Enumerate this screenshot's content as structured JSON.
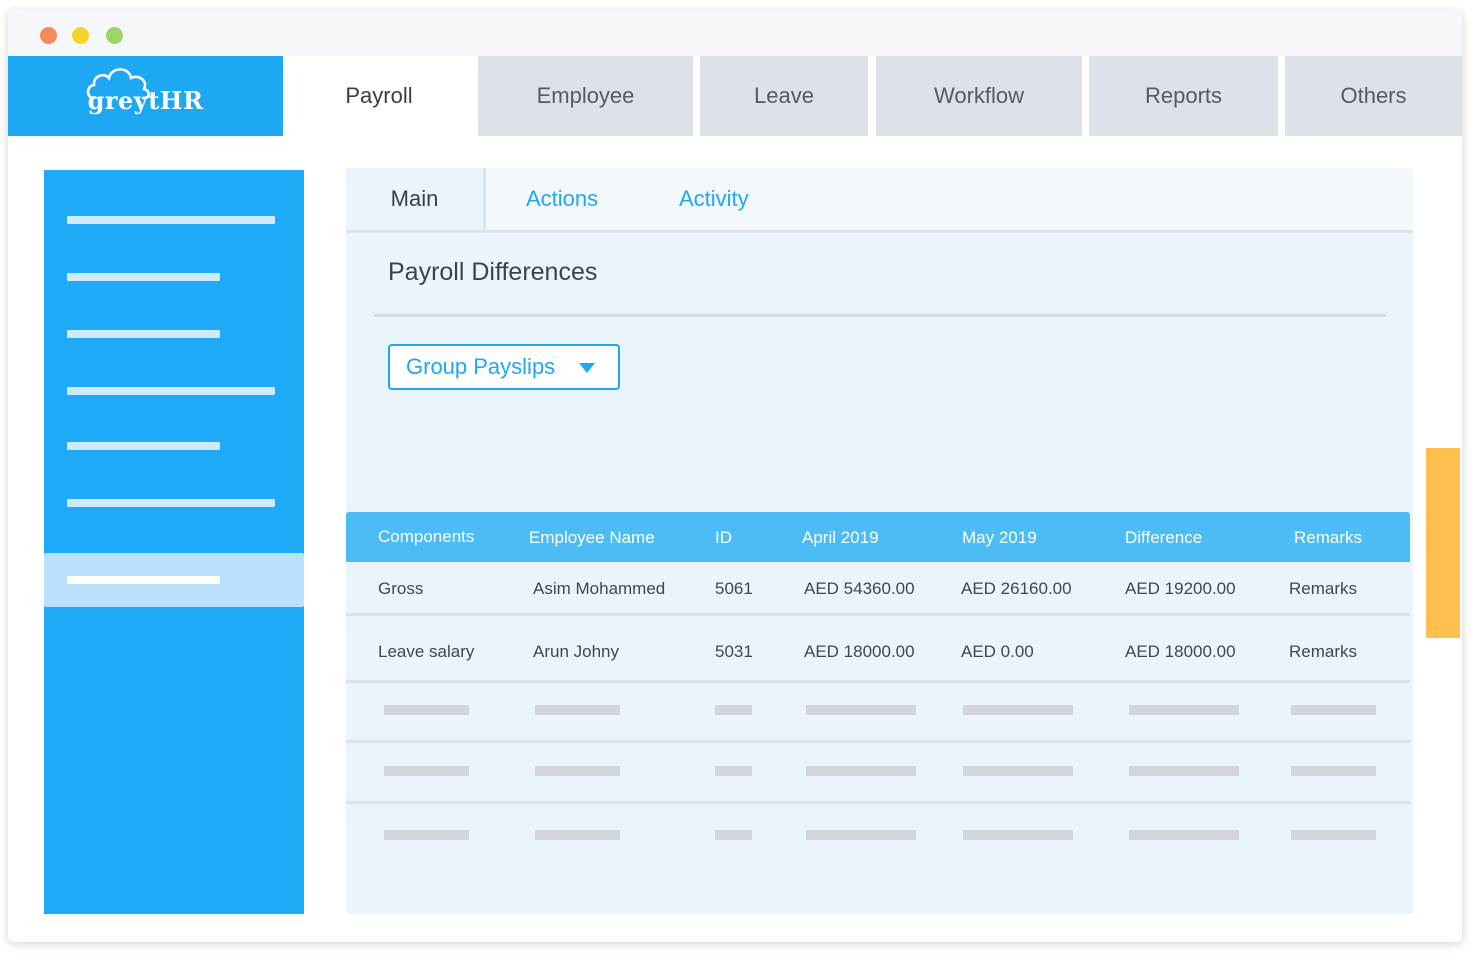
{
  "window": {
    "controls": [
      "close",
      "minimize",
      "maximize"
    ]
  },
  "brand": {
    "logo_text": "greytHR",
    "logo_icon": "cloud-icon",
    "color": "#1ea8f2"
  },
  "top_nav": {
    "tabs": [
      {
        "label": "Payroll",
        "active": true
      },
      {
        "label": "Employee",
        "active": false
      },
      {
        "label": "Leave",
        "active": false
      },
      {
        "label": "Workflow",
        "active": false
      },
      {
        "label": "Reports",
        "active": false
      },
      {
        "label": "Others",
        "active": false
      }
    ]
  },
  "sidebar": {
    "item_count": 7,
    "active_index": 6,
    "color": "#1eaaf6"
  },
  "sub_tabs": [
    {
      "label": "Main",
      "active": true
    },
    {
      "label": "Actions",
      "active": false
    },
    {
      "label": "Activity",
      "active": false
    }
  ],
  "page": {
    "title": "Payroll Differences"
  },
  "dropdown": {
    "selected": "Group Payslips",
    "icon": "caret-down-icon"
  },
  "table": {
    "columns": [
      "Components",
      "Employee Name",
      "ID",
      "April 2019",
      "May 2019",
      "Difference",
      "Remarks"
    ],
    "rows": [
      [
        "Gross",
        "Asim Mohammed",
        "5061",
        "AED 54360.00",
        "AED 26160.00",
        "AED 19200.00",
        "Remarks"
      ],
      [
        "Leave salary",
        "Arun Johny",
        "5031",
        "AED 18000.00",
        "AED 0.00",
        "AED 18000.00",
        "Remarks"
      ]
    ],
    "placeholder_rows": 3,
    "header_color": "#4cbcf5"
  },
  "scrollbar": {
    "color": "#ffc04d"
  }
}
